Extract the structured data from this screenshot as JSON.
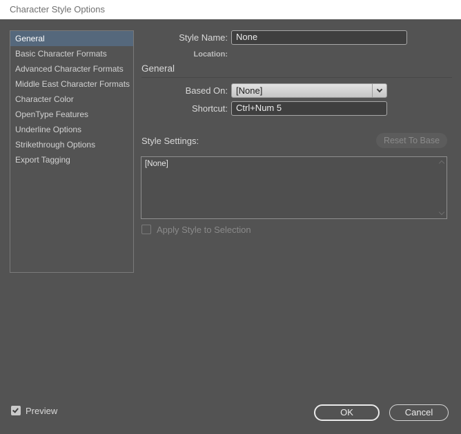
{
  "titlebar": {
    "title": "Character Style Options"
  },
  "sidebar": {
    "items": [
      {
        "label": "General",
        "selected": true
      },
      {
        "label": "Basic Character Formats",
        "selected": false
      },
      {
        "label": "Advanced Character Formats",
        "selected": false
      },
      {
        "label": "Middle East Character Formats",
        "selected": false
      },
      {
        "label": "Character Color",
        "selected": false
      },
      {
        "label": "OpenType Features",
        "selected": false
      },
      {
        "label": "Underline Options",
        "selected": false
      },
      {
        "label": "Strikethrough Options",
        "selected": false
      },
      {
        "label": "Export Tagging",
        "selected": false
      }
    ]
  },
  "main": {
    "style_name_label": "Style Name:",
    "style_name_value": "None",
    "location_label": "Location:",
    "section_heading": "General",
    "based_on_label": "Based On:",
    "based_on_value": "[None]",
    "based_on_icon": "chevron-down",
    "shortcut_label": "Shortcut:",
    "shortcut_value": "Ctrl+Num 5",
    "style_settings_label": "Style Settings:",
    "reset_to_base_label": "Reset To Base",
    "style_settings_value": "[None]",
    "apply_style_label": "Apply Style to Selection",
    "apply_style_checked": false
  },
  "footer": {
    "preview_label": "Preview",
    "preview_checked": true,
    "ok_label": "OK",
    "cancel_label": "Cancel"
  },
  "colors": {
    "titlebar_bg": "#ffffff",
    "titlebar_text": "#6f6f6f",
    "dialog_bg": "#535353",
    "sidebar_selected_bg": "#55687c",
    "input_bg": "#3f3f3f",
    "input_border": "#a8a8a8",
    "dropdown_bg": "#d4d4d4",
    "text_light": "#d9d9d9",
    "disabled_text": "#8a8a8a",
    "button_border": "#ebebeb"
  }
}
